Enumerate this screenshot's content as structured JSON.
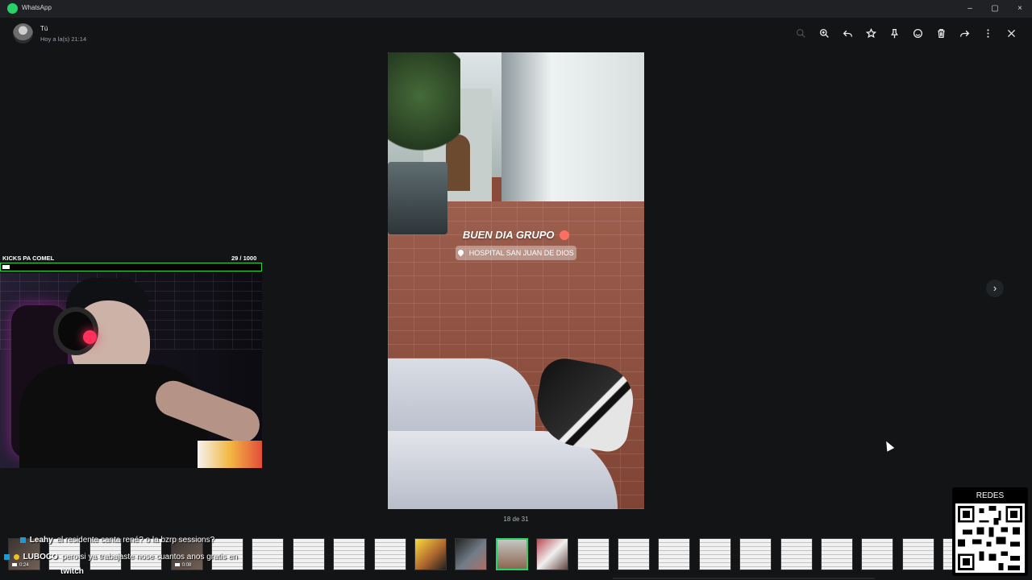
{
  "window": {
    "app_name": "WhatsApp",
    "minimize_glyph": "–",
    "maximize_glyph": "▢",
    "close_glyph": "×"
  },
  "sender": {
    "name": "Tú",
    "timestamp": "Hoy a la(s) 21:14"
  },
  "toolbar_icons": [
    "search-icon",
    "zoom-in-icon",
    "reply-icon",
    "star-icon",
    "pin-icon",
    "emoji-icon",
    "delete-icon",
    "forward-icon",
    "more-options-icon",
    "close-icon"
  ],
  "photo": {
    "caption": "BUEN DIA GRUPO",
    "location": "HOSPITAL SAN JUAN DE DIOS"
  },
  "media": {
    "counter": "18 de 31",
    "next_glyph": "›"
  },
  "stream_overlay": {
    "title": "KICKS PA COMEL",
    "current": 29,
    "goal": 1000,
    "count_text": "29 / 1000"
  },
  "chat": [
    {
      "username": "Leahy",
      "message": "el residente canta rené? o la bzrp sessions?",
      "badge_color": "#1a9bd7"
    },
    {
      "username": "LUBOCO",
      "message": "pero si ya trabajaste nose cuantos anos gratis en",
      "badge_color": "#f0c020"
    },
    {
      "username": "",
      "message": "twitch",
      "badge_color": ""
    }
  ],
  "thumbnails": [
    {
      "type": "video",
      "duration": "0:24"
    },
    {
      "type": "doc"
    },
    {
      "type": "doc"
    },
    {
      "type": "doc"
    },
    {
      "type": "video",
      "duration": "0:08"
    },
    {
      "type": "doc"
    },
    {
      "type": "doc"
    },
    {
      "type": "doc"
    },
    {
      "type": "doc"
    },
    {
      "type": "doc"
    },
    {
      "type": "photo-yellow"
    },
    {
      "type": "photo-dark"
    },
    {
      "type": "photo-current"
    },
    {
      "type": "photo-red"
    },
    {
      "type": "doc"
    },
    {
      "type": "doc"
    },
    {
      "type": "doc"
    },
    {
      "type": "doc"
    },
    {
      "type": "doc"
    },
    {
      "type": "doc"
    },
    {
      "type": "doc"
    },
    {
      "type": "doc"
    },
    {
      "type": "doc"
    },
    {
      "type": "doc"
    }
  ],
  "qr_panel": {
    "label": "REDES"
  },
  "colors": {
    "accent": "#25d366",
    "progress_border": "#32d14b"
  }
}
